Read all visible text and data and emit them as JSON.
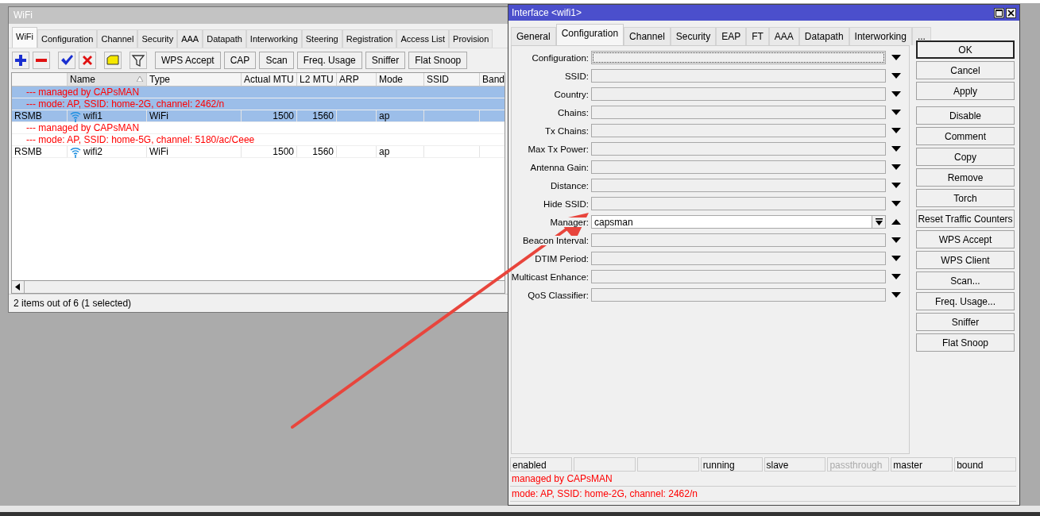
{
  "wifi_window": {
    "title": "WiFi",
    "tabs": [
      {
        "label": "WiFi",
        "selected": true
      },
      {
        "label": "Configuration",
        "selected": false
      },
      {
        "label": "Channel",
        "selected": false
      },
      {
        "label": "Security",
        "selected": false
      },
      {
        "label": "AAA",
        "selected": false
      },
      {
        "label": "Datapath",
        "selected": false
      },
      {
        "label": "Interworking",
        "selected": false
      },
      {
        "label": "Steering",
        "selected": false
      },
      {
        "label": "Registration",
        "selected": false
      },
      {
        "label": "Access List",
        "selected": false
      },
      {
        "label": "Provision",
        "selected": false
      }
    ],
    "toolbar": {
      "icon_buttons": [
        {
          "kind": "add"
        },
        {
          "kind": "remove"
        },
        {
          "kind": "enable"
        },
        {
          "kind": "disable"
        },
        {
          "kind": "comment"
        },
        {
          "kind": "filter"
        }
      ],
      "buttons": [
        "WPS Accept",
        "CAP",
        "Scan",
        "Freq. Usage",
        "Sniffer",
        "Flat Snoop"
      ]
    },
    "table": {
      "columns": [
        {
          "label": "Name",
          "sorted": true
        },
        {
          "label": "Type",
          "sorted": false
        },
        {
          "label": "Actual MTU",
          "sorted": false
        },
        {
          "label": "L2 MTU",
          "sorted": false
        },
        {
          "label": "ARP",
          "sorted": false
        },
        {
          "label": "Mode",
          "sorted": false
        },
        {
          "label": "SSID",
          "sorted": false
        },
        {
          "label": "Band",
          "sorted": false
        }
      ],
      "rows": [
        {
          "selected": true,
          "comment_lines": [
            "--- managed by CAPsMAN",
            "--- mode: AP, SSID: home-2G, channel: 2462/n"
          ],
          "column_1": "RSMB",
          "name": "wifi1",
          "type": "WiFi",
          "actual_mtu": "1500",
          "l2_mtu": "1560",
          "mode": "ap"
        },
        {
          "selected": false,
          "comment_lines": [
            "--- managed by CAPsMAN",
            "--- mode: AP, SSID: home-5G, channel: 5180/ac/Ceee"
          ],
          "column_1": "RSMB",
          "name": "wifi2",
          "type": "WiFi",
          "actual_mtu": "1500",
          "l2_mtu": "1560",
          "mode": "ap"
        }
      ]
    },
    "status_bar": "2 items out of 6 (1 selected)"
  },
  "interface_dialog": {
    "title": "Interface <wifi1>",
    "tabs": [
      {
        "label": "General",
        "selected": false
      },
      {
        "label": "Configuration",
        "selected": true
      },
      {
        "label": "Channel",
        "selected": false
      },
      {
        "label": "Security",
        "selected": false
      },
      {
        "label": "EAP",
        "selected": false
      },
      {
        "label": "FT",
        "selected": false
      },
      {
        "label": "AAA",
        "selected": false
      },
      {
        "label": "Datapath",
        "selected": false
      },
      {
        "label": "Interworking",
        "selected": false
      },
      {
        "label": "...",
        "selected": false
      }
    ],
    "fields": [
      {
        "label": "Configuration:",
        "focused": true,
        "expanded": false
      },
      {
        "label": "SSID:",
        "focused": false,
        "expanded": false
      },
      {
        "label": "Country:",
        "focused": false,
        "expanded": false
      },
      {
        "label": "Chains:",
        "focused": false,
        "expanded": false
      },
      {
        "label": "Tx Chains:",
        "focused": false,
        "expanded": false
      },
      {
        "label": "Max Tx Power:",
        "focused": false,
        "expanded": false
      },
      {
        "label": "Antenna Gain:",
        "focused": false,
        "expanded": false
      },
      {
        "label": "Distance:",
        "focused": false,
        "expanded": false
      },
      {
        "label": "Hide SSID:",
        "focused": false,
        "expanded": false
      },
      {
        "label": "Manager:",
        "value": "capsman",
        "focused": false,
        "expanded": true
      },
      {
        "label": "Beacon Interval:",
        "focused": false,
        "expanded": false
      },
      {
        "label": "DTIM Period:",
        "focused": false,
        "expanded": false
      },
      {
        "label": "Multicast Enhance:",
        "focused": false,
        "expanded": false
      },
      {
        "label": "QoS Classifier:",
        "focused": false,
        "expanded": false
      }
    ],
    "button_groups": [
      [
        {
          "label": "OK",
          "default": true
        },
        {
          "label": "Cancel",
          "default": false
        },
        {
          "label": "Apply",
          "default": false
        }
      ],
      [
        {
          "label": "Disable",
          "default": false
        },
        {
          "label": "Comment",
          "default": false
        },
        {
          "label": "Copy",
          "default": false
        },
        {
          "label": "Remove",
          "default": false
        },
        {
          "label": "Torch",
          "default": false
        },
        {
          "label": "Reset Traffic Counters",
          "default": false
        },
        {
          "label": "WPS Accept",
          "default": false
        },
        {
          "label": "WPS Client",
          "default": false
        },
        {
          "label": "Scan...",
          "default": false
        },
        {
          "label": "Freq. Usage...",
          "default": false
        },
        {
          "label": "Sniffer",
          "default": false
        },
        {
          "label": "Flat Snoop",
          "default": false
        }
      ]
    ],
    "status_flags": [
      {
        "kind": "text",
        "text": "enabled",
        "dimmed": false
      },
      {
        "kind": "empty"
      },
      {
        "kind": "empty"
      },
      {
        "kind": "text",
        "text": "running",
        "dimmed": false
      },
      {
        "kind": "text",
        "text": "slave",
        "dimmed": false
      },
      {
        "kind": "text",
        "text": "passthrough",
        "dimmed": true
      },
      {
        "kind": "text",
        "text": "master",
        "dimmed": false
      },
      {
        "kind": "text",
        "text": "bound",
        "dimmed": false
      }
    ],
    "status_lines": [
      "managed by CAPsMAN",
      "mode: AP, SSID: home-2G, channel: 2462/n"
    ]
  }
}
